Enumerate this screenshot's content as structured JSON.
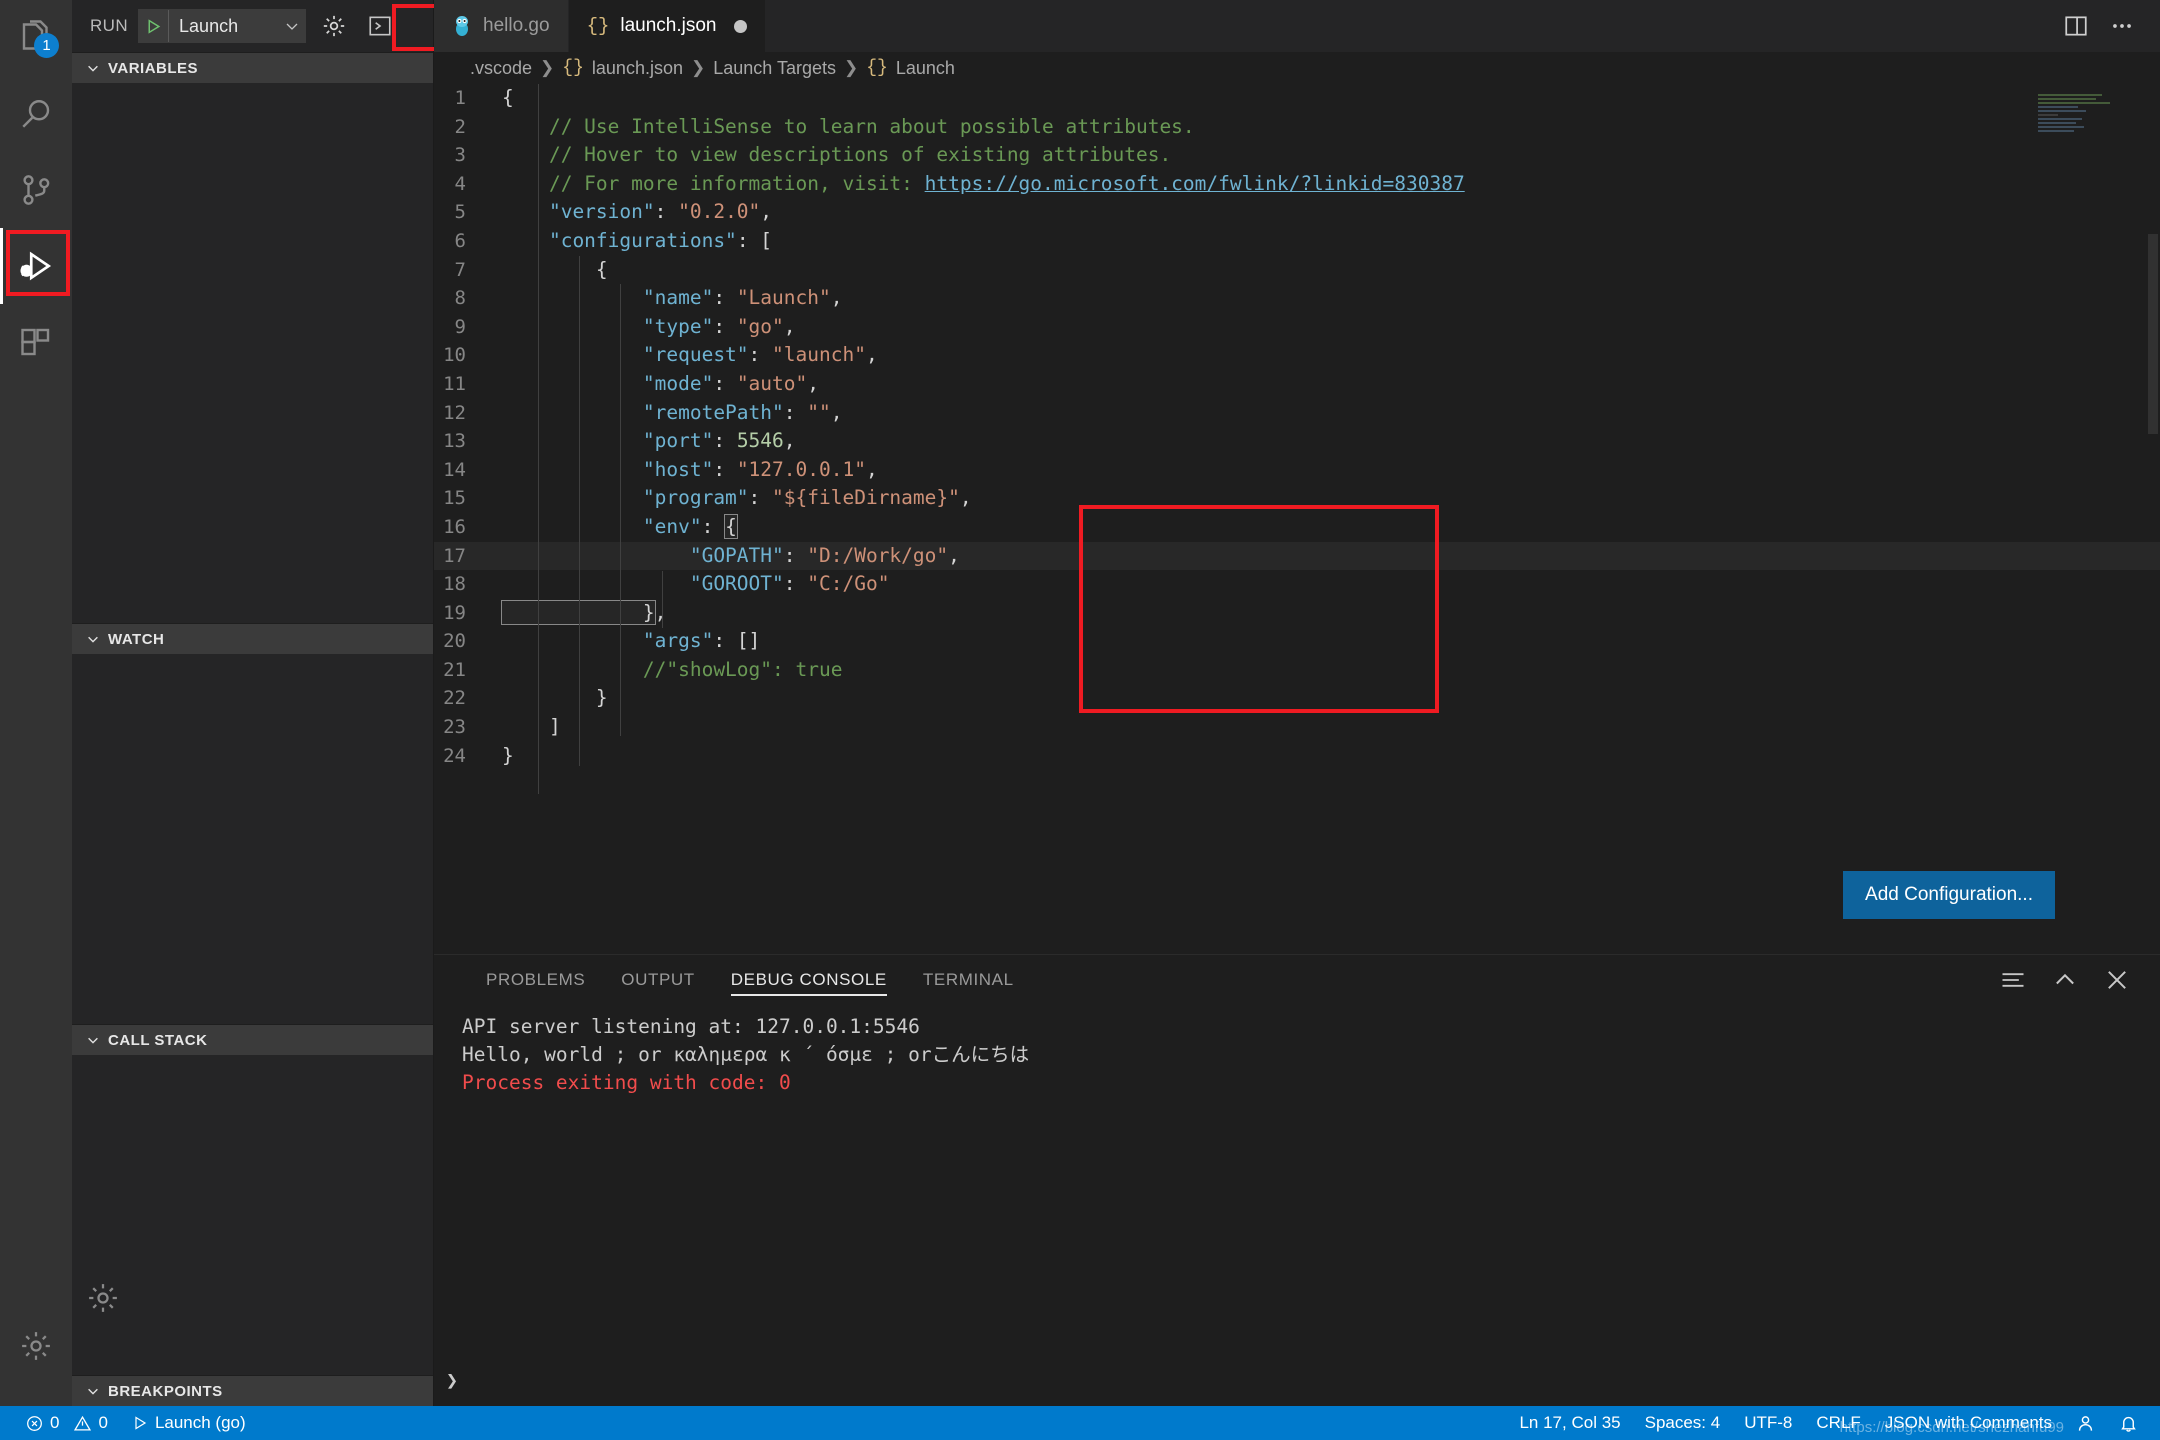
{
  "activity_bar": {
    "items": [
      {
        "name": "explorer",
        "icon": "files-icon",
        "badge": "1"
      },
      {
        "name": "search",
        "icon": "search-icon",
        "badge": null
      },
      {
        "name": "source-control",
        "icon": "source-control-icon",
        "badge": null
      },
      {
        "name": "run-and-debug",
        "icon": "run-debug-icon",
        "badge": null,
        "active": true
      },
      {
        "name": "extensions",
        "icon": "extensions-icon",
        "badge": null
      }
    ],
    "bottom": [
      {
        "name": "manage",
        "icon": "gear-icon"
      }
    ]
  },
  "sidebar": {
    "run_label": "RUN",
    "configuration": "Launch",
    "start_debug_title": "Start Debugging",
    "open_config_title": "Open launch.json",
    "open_console_title": "Debug Console",
    "sections": [
      {
        "title": "VARIABLES"
      },
      {
        "title": "WATCH"
      },
      {
        "title": "CALL STACK"
      },
      {
        "title": "BREAKPOINTS"
      }
    ]
  },
  "editor": {
    "tabs": [
      {
        "label": "hello.go",
        "icon": "go-gopher-icon",
        "active": false,
        "dirty": false
      },
      {
        "label": "launch.json",
        "icon": "json-braces-icon",
        "active": true,
        "dirty": true
      }
    ],
    "tab_actions": [
      {
        "name": "split-editor",
        "icon": "split-editor-icon"
      },
      {
        "name": "more-actions",
        "icon": "ellipsis-icon"
      }
    ],
    "breadcrumb": [
      ".vscode",
      "launch.json",
      "Launch Targets",
      "Launch"
    ],
    "breadcrumb_json_icon": "{}",
    "add_configuration_label": "Add Configuration...",
    "lines": [
      {
        "n": "1",
        "tokens": [
          {
            "t": "punc",
            "v": "{"
          }
        ]
      },
      {
        "n": "2",
        "tokens": [
          {
            "t": "com",
            "v": "    // Use IntelliSense to learn about possible attributes."
          }
        ]
      },
      {
        "n": "3",
        "tokens": [
          {
            "t": "com",
            "v": "    // Hover to view descriptions of existing attributes."
          }
        ]
      },
      {
        "n": "4",
        "tokens": [
          {
            "t": "com",
            "v": "    // For more information, visit: "
          },
          {
            "t": "link",
            "v": "https://go.microsoft.com/fwlink/?linkid=830387"
          }
        ]
      },
      {
        "n": "5",
        "tokens": [
          {
            "t": "key",
            "v": "    \"version\""
          },
          {
            "t": "punc",
            "v": ": "
          },
          {
            "t": "str",
            "v": "\"0.2.0\""
          },
          {
            "t": "punc",
            "v": ","
          }
        ]
      },
      {
        "n": "6",
        "tokens": [
          {
            "t": "key",
            "v": "    \"configurations\""
          },
          {
            "t": "punc",
            "v": ": ["
          }
        ]
      },
      {
        "n": "7",
        "tokens": [
          {
            "t": "punc",
            "v": "        {"
          }
        ]
      },
      {
        "n": "8",
        "tokens": [
          {
            "t": "key",
            "v": "            \"name\""
          },
          {
            "t": "punc",
            "v": ": "
          },
          {
            "t": "str",
            "v": "\"Launch\""
          },
          {
            "t": "punc",
            "v": ","
          }
        ]
      },
      {
        "n": "9",
        "tokens": [
          {
            "t": "key",
            "v": "            \"type\""
          },
          {
            "t": "punc",
            "v": ": "
          },
          {
            "t": "str",
            "v": "\"go\""
          },
          {
            "t": "punc",
            "v": ","
          }
        ]
      },
      {
        "n": "10",
        "tokens": [
          {
            "t": "key",
            "v": "            \"request\""
          },
          {
            "t": "punc",
            "v": ": "
          },
          {
            "t": "str",
            "v": "\"launch\""
          },
          {
            "t": "punc",
            "v": ","
          }
        ]
      },
      {
        "n": "11",
        "tokens": [
          {
            "t": "key",
            "v": "            \"mode\""
          },
          {
            "t": "punc",
            "v": ": "
          },
          {
            "t": "str",
            "v": "\"auto\""
          },
          {
            "t": "punc",
            "v": ","
          }
        ]
      },
      {
        "n": "12",
        "tokens": [
          {
            "t": "key",
            "v": "            \"remotePath\""
          },
          {
            "t": "punc",
            "v": ": "
          },
          {
            "t": "str",
            "v": "\"\""
          },
          {
            "t": "punc",
            "v": ","
          }
        ]
      },
      {
        "n": "13",
        "tokens": [
          {
            "t": "key",
            "v": "            \"port\""
          },
          {
            "t": "punc",
            "v": ": "
          },
          {
            "t": "num",
            "v": "5546"
          },
          {
            "t": "punc",
            "v": ","
          }
        ]
      },
      {
        "n": "14",
        "tokens": [
          {
            "t": "key",
            "v": "            \"host\""
          },
          {
            "t": "punc",
            "v": ": "
          },
          {
            "t": "str",
            "v": "\"127.0.0.1\""
          },
          {
            "t": "punc",
            "v": ","
          }
        ]
      },
      {
        "n": "15",
        "tokens": [
          {
            "t": "key",
            "v": "            \"program\""
          },
          {
            "t": "punc",
            "v": ": "
          },
          {
            "t": "str",
            "v": "\"${fileDirname}\""
          },
          {
            "t": "punc",
            "v": ","
          }
        ]
      },
      {
        "n": "16",
        "tokens": [
          {
            "t": "key",
            "v": "            \"env\""
          },
          {
            "t": "punc",
            "v": ": "
          },
          {
            "t": "bracket",
            "v": "{"
          }
        ]
      },
      {
        "n": "17",
        "current": true,
        "tokens": [
          {
            "t": "key",
            "v": "                \"GOPATH\""
          },
          {
            "t": "punc",
            "v": ": "
          },
          {
            "t": "str",
            "v": "\"D:/Work/go\""
          },
          {
            "t": "punc",
            "v": ","
          }
        ]
      },
      {
        "n": "18",
        "tokens": [
          {
            "t": "key",
            "v": "                \"GOROOT\""
          },
          {
            "t": "punc",
            "v": ": "
          },
          {
            "t": "str",
            "v": "\"C:/Go\""
          }
        ]
      },
      {
        "n": "19",
        "tokens": [
          {
            "t": "bracket",
            "v": "            }"
          },
          {
            "t": "punc",
            "v": ","
          }
        ]
      },
      {
        "n": "20",
        "tokens": [
          {
            "t": "key",
            "v": "            \"args\""
          },
          {
            "t": "punc",
            "v": ": "
          },
          {
            "t": "punc",
            "v": "[]"
          }
        ]
      },
      {
        "n": "21",
        "tokens": [
          {
            "t": "com",
            "v": "            //\"showLog\": true"
          }
        ]
      },
      {
        "n": "22",
        "tokens": [
          {
            "t": "punc",
            "v": "        }"
          }
        ]
      },
      {
        "n": "23",
        "tokens": [
          {
            "t": "punc",
            "v": "    ]"
          }
        ]
      },
      {
        "n": "24",
        "tokens": [
          {
            "t": "punc",
            "v": "}"
          }
        ]
      }
    ]
  },
  "panel": {
    "tabs": [
      {
        "label": "PROBLEMS",
        "active": false
      },
      {
        "label": "OUTPUT",
        "active": false
      },
      {
        "label": "DEBUG CONSOLE",
        "active": true
      },
      {
        "label": "TERMINAL",
        "active": false
      }
    ],
    "actions": [
      {
        "name": "clear-console",
        "icon": "clear-icon"
      },
      {
        "name": "maximize-panel",
        "icon": "chevron-up-icon"
      },
      {
        "name": "close-panel",
        "icon": "close-icon"
      }
    ],
    "console_lines": [
      {
        "text": "API server listening at: 127.0.0.1:5546",
        "error": false
      },
      {
        "text": "Hello, world ; or καλημερα κ ´ όσμε ; orこんにちは",
        "error": false
      },
      {
        "text": "Process exiting with code: 0",
        "error": true
      }
    ],
    "prompt_caret": "❯"
  },
  "status_bar": {
    "errors": "0",
    "warnings": "0",
    "debug_target": "Launch (go)",
    "position": "Ln 17, Col 35",
    "indentation": "Spaces: 4",
    "encoding": "UTF-8",
    "eol": "CRLF",
    "language": "JSON with Comments",
    "feedback_icon": "smiley-icon",
    "bell_icon": "bell-icon",
    "watermark": "https://blog.csdn.net/shezhanfu99"
  },
  "colors": {
    "accent": "#007acc",
    "highlight_box": "#f01b22",
    "button": "#0e639c",
    "badge": "#0d7fcf"
  }
}
